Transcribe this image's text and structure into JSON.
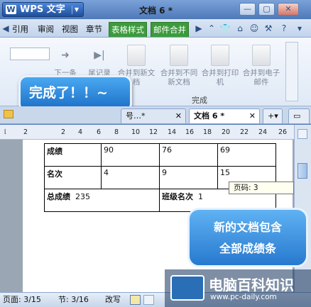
{
  "titlebar": {
    "app": "WPS 文字",
    "doc": "文档 6 *"
  },
  "tabs": [
    "引用",
    "审阅",
    "视图",
    "章节",
    "表格样式",
    "邮件合并"
  ],
  "ribbon": {
    "buttons": [
      {
        "label": "下一条"
      },
      {
        "label": "尾记录"
      },
      {
        "label": "合并到新文档"
      },
      {
        "label": "合并到不同新文档"
      },
      {
        "label": "合并到打印机"
      },
      {
        "label": "合并到电子邮件"
      }
    ],
    "group": "完成"
  },
  "bubble": "完成了！！~",
  "doctabs": [
    {
      "label": "号…*"
    },
    {
      "label": "文档 6 *"
    }
  ],
  "ruler": [
    "2",
    "2",
    "4",
    "6",
    "8",
    "10",
    "12",
    "14",
    "16",
    "18",
    "20",
    "22",
    "24",
    "26"
  ],
  "table": {
    "r1": [
      "成绩",
      "90",
      "76",
      "69"
    ],
    "r2": [
      "名次",
      "4",
      "9",
      "15"
    ],
    "r3": {
      "label": "总成绩",
      "value": "235",
      "label2": "班级名次",
      "value2": "1"
    }
  },
  "tooltip": "页码: 3",
  "callout": [
    "新的文档包含",
    "全部成绩条"
  ],
  "status": {
    "page": "页面: 3/15",
    "section": "节: 3/16",
    "track": "改写"
  },
  "watermark": {
    "name": "电脑百科知识",
    "url": "www.pc-daily.com"
  }
}
